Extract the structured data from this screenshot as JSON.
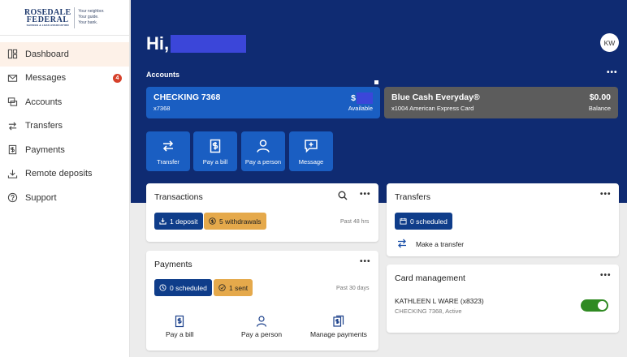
{
  "logo": {
    "line1": "ROSEDALE",
    "line2": "FEDERAL",
    "line3": "SAVINGS & LOAN ASSOCIATION",
    "tag1": "Your neighbor.",
    "tag2": "Your guide.",
    "tag3": "Your bank."
  },
  "nav": [
    {
      "label": "Dashboard",
      "icon": "dashboard-icon",
      "active": true
    },
    {
      "label": "Messages",
      "icon": "envelope-icon",
      "badge": "4"
    },
    {
      "label": "Accounts",
      "icon": "accounts-icon"
    },
    {
      "label": "Transfers",
      "icon": "transfer-arrows-icon"
    },
    {
      "label": "Payments",
      "icon": "dollar-doc-icon"
    },
    {
      "label": "Remote deposits",
      "icon": "download-icon"
    },
    {
      "label": "Support",
      "icon": "help-icon"
    }
  ],
  "header": {
    "greeting": "Hi,",
    "avatar_initials": "KW",
    "accounts_title": "Accounts",
    "more": "•••",
    "colors": {
      "header_bg": "#0f2b72",
      "checking": "#1a5ec2",
      "credit": "#5c5c5c"
    }
  },
  "accounts": [
    {
      "name": "CHECKING 7368",
      "number": "x7368",
      "amount": "$",
      "sub": "Available"
    },
    {
      "name": "Blue Cash Everyday®",
      "number": "x1004 American Express Card",
      "amount": "$0.00",
      "sub": "Balance"
    }
  ],
  "quick_actions": [
    {
      "label": "Transfer",
      "icon": "transfer-icon"
    },
    {
      "label": "Pay a bill",
      "icon": "bill-icon"
    },
    {
      "label": "Pay a person",
      "icon": "person-icon"
    },
    {
      "label": "Message",
      "icon": "message-icon"
    }
  ],
  "transactions": {
    "title": "Transactions",
    "deposits": "1 deposit",
    "withdrawals": "5 withdrawals",
    "period": "Past 48 hrs",
    "more": "•••"
  },
  "transfers": {
    "title": "Transfers",
    "scheduled": "0 scheduled",
    "make": "Make a transfer",
    "more": "•••"
  },
  "payments": {
    "title": "Payments",
    "scheduled": "0 scheduled",
    "sent": "1 sent",
    "period": "Past 30 days",
    "more": "•••",
    "actions": [
      {
        "label": "Pay a bill"
      },
      {
        "label": "Pay a person"
      },
      {
        "label": "Manage payments"
      }
    ]
  },
  "card_management": {
    "title": "Card management",
    "holder": "KATHLEEN L WARE (x8323)",
    "detail": "CHECKING 7368, Active",
    "more": "•••",
    "toggle_on": true
  }
}
